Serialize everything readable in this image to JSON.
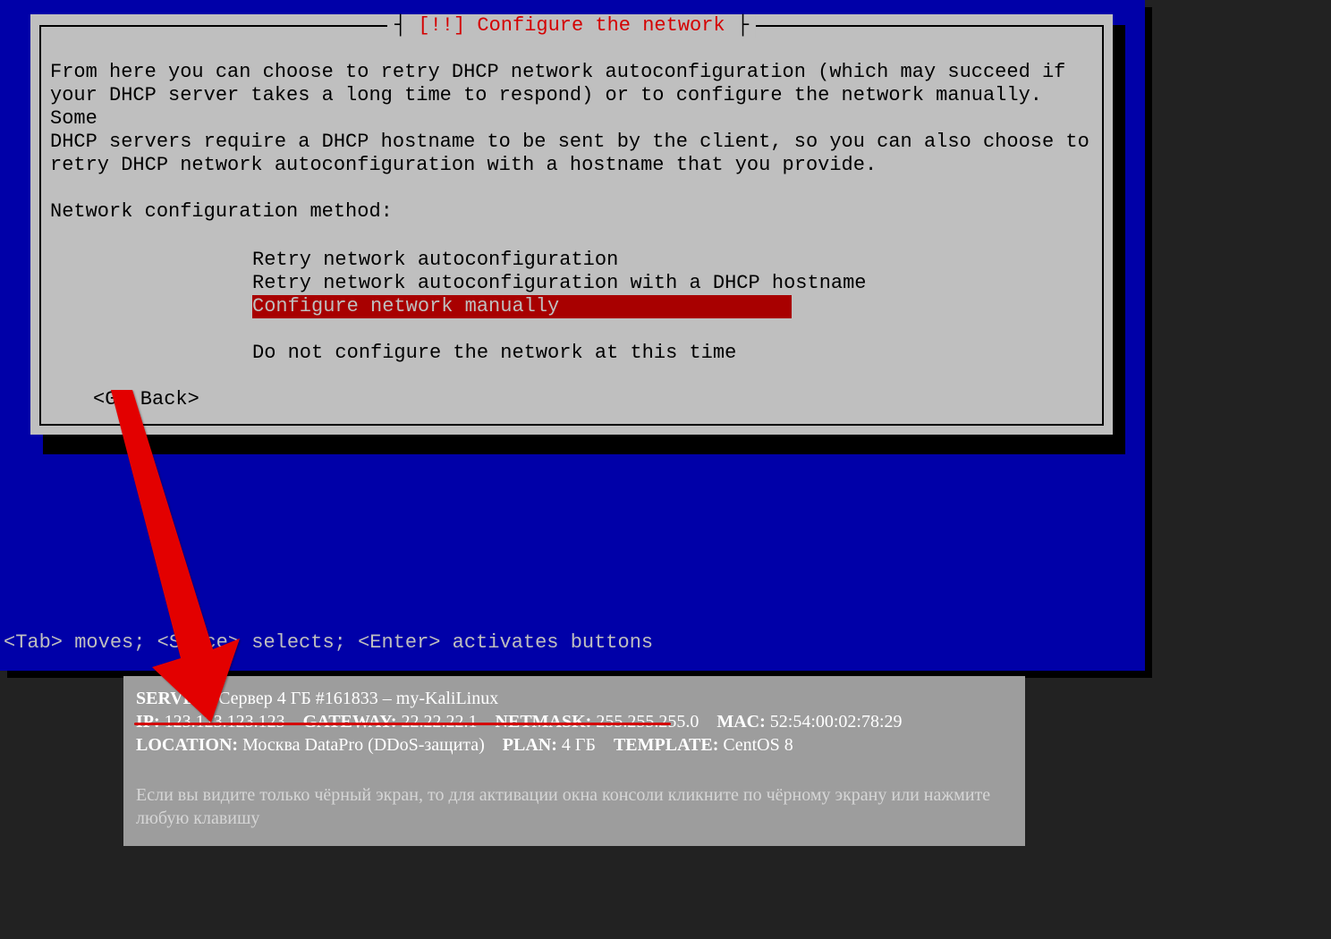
{
  "dialog": {
    "title_prefix": "[!!]",
    "title": "Configure the network",
    "description": "From here you can choose to retry DHCP network autoconfiguration (which may succeed if\nyour DHCP server takes a long time to respond) or to configure the network manually. Some\nDHCP servers require a DHCP hostname to be sent by the client, so you can also choose to\nretry DHCP network autoconfiguration with a hostname that you provide.",
    "prompt": "Network configuration method:",
    "options": {
      "retry": "Retry network autoconfiguration",
      "retry_hostname": "Retry network autoconfiguration with a DHCP hostname",
      "manual": "Configure network manually",
      "skip": "Do not configure the network at this time"
    },
    "go_back": "<Go Back>"
  },
  "hint": "<Tab> moves; <Space> selects; <Enter> activates buttons",
  "info": {
    "server_k": "SERVER:",
    "server_v": "Сервер 4 ГБ #161833 – my-KaliLinux",
    "ip_k": "IP:",
    "ip_v": "123.123.123.123",
    "gateway_k": "GATEWAY:",
    "gateway_v": "22.22.22.1",
    "netmask_k": "NETMASK:",
    "netmask_v": "255.255.255.0",
    "mac_k": "MAC:",
    "mac_v": "52:54:00:02:78:29",
    "location_k": "LOCATION:",
    "location_v": "Москва DataPro (DDoS-защита)",
    "plan_k": "PLAN:",
    "plan_v": "4 ГБ",
    "template_k": "TEMPLATE:",
    "template_v": "CentOS 8",
    "note": "Если вы видите только чёрный экран, то для активации окна консоли кликните по чёрному экрану или нажмите любую клавишу"
  }
}
